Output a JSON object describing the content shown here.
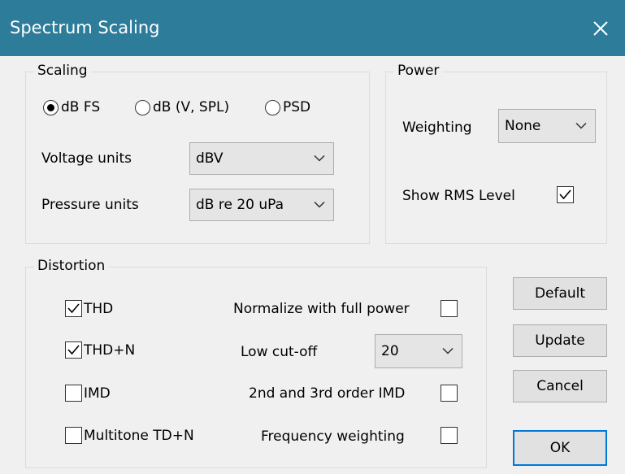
{
  "window": {
    "title": "Spectrum Scaling",
    "accent_color": "#2d7d9a"
  },
  "scaling": {
    "group_label": "Scaling",
    "radios": [
      {
        "label": "dB FS",
        "selected": true
      },
      {
        "label": "dB (V, SPL)",
        "selected": false
      },
      {
        "label": "PSD",
        "selected": false
      }
    ],
    "voltage_units_label": "Voltage units",
    "voltage_units_value": "dBV",
    "pressure_units_label": "Pressure units",
    "pressure_units_value": "dB re 20 uPa"
  },
  "power": {
    "group_label": "Power",
    "weighting_label": "Weighting",
    "weighting_value": "None",
    "show_rms_label": "Show RMS Level",
    "show_rms_checked": true
  },
  "distortion": {
    "group_label": "Distortion",
    "thd_label": "THD",
    "thd_checked": true,
    "thdn_label": "THD+N",
    "thdn_checked": true,
    "imd_label": "IMD",
    "imd_checked": false,
    "multitone_label": "Multitone TD+N",
    "multitone_checked": false,
    "normalize_label": "Normalize with full power",
    "normalize_checked": false,
    "lowcut_label": "Low cut-off",
    "lowcut_value": "20",
    "imd_order_label": "2nd and 3rd order IMD",
    "imd_order_checked": false,
    "freq_weighting_label": "Frequency weighting",
    "freq_weighting_checked": false
  },
  "buttons": {
    "default_label": "Default",
    "update_label": "Update",
    "cancel_label": "Cancel",
    "ok_label": "OK"
  },
  "icons": {
    "close": "close-icon",
    "chevron": "chevron-down-icon",
    "check": "checkmark-icon"
  }
}
